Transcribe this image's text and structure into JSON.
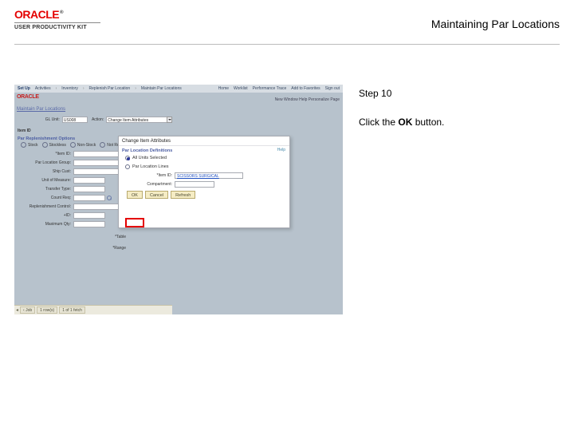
{
  "header": {
    "brand_name": "ORACLE",
    "brand_subtitle": "USER PRODUCTIVITY KIT",
    "doc_title": "Maintaining Par Locations"
  },
  "instruction": {
    "step_label": "Step 10",
    "text_before": "Click the ",
    "bold_word": "OK",
    "text_after": " button."
  },
  "screenshot": {
    "topbar": {
      "menu": "Set Up",
      "crumbs": [
        "Activities",
        "Inventory",
        "Replenish Par Location",
        "Maintain Par Locations"
      ],
      "right_links": [
        "Home",
        "Worklist",
        "Performance Trace",
        "Add to Favorites",
        "Sign out"
      ]
    },
    "brand": "ORACLE",
    "userline": "New Window   Help   Personalize Page",
    "section_title": "Maintain Par Locations",
    "left_form": {
      "row1_label": "GL Unit:",
      "row1_value": "US008",
      "row1_extra_label": "Action:",
      "row1_extra_value": "Change Item Attributes",
      "options_header": "Par Replenishment Options",
      "radios": [
        "Stock",
        "Stockless",
        "Non-Stock",
        "Not Replenished"
      ],
      "rows": [
        "*Item ID:",
        "Par Location Group:",
        "Ship Cust:",
        "Unit of Measure:",
        "Transfer Type:",
        "Count Req:",
        "Replenishment Control:",
        "+ID:",
        "Maximum Qty:"
      ]
    },
    "dialog": {
      "title": "Change Item Attributes",
      "help": "Help",
      "subhdr": "Par Location Definitions",
      "opt_all": "All Units Selected",
      "opt_lines": "Par Location Lines",
      "item_label": "*Item ID:",
      "item_value": "SCISSORS SURGICAL",
      "compartment_label": "Compartment:",
      "buttons": {
        "ok": "OK",
        "cancel": "Cancel",
        "refresh": "Refresh"
      }
    },
    "under_labels": [
      "*Table",
      "*Range"
    ],
    "status": {
      "back": "‹ Job",
      "mid": "1 row(s)",
      "last": "1 of 1 fetch"
    }
  }
}
